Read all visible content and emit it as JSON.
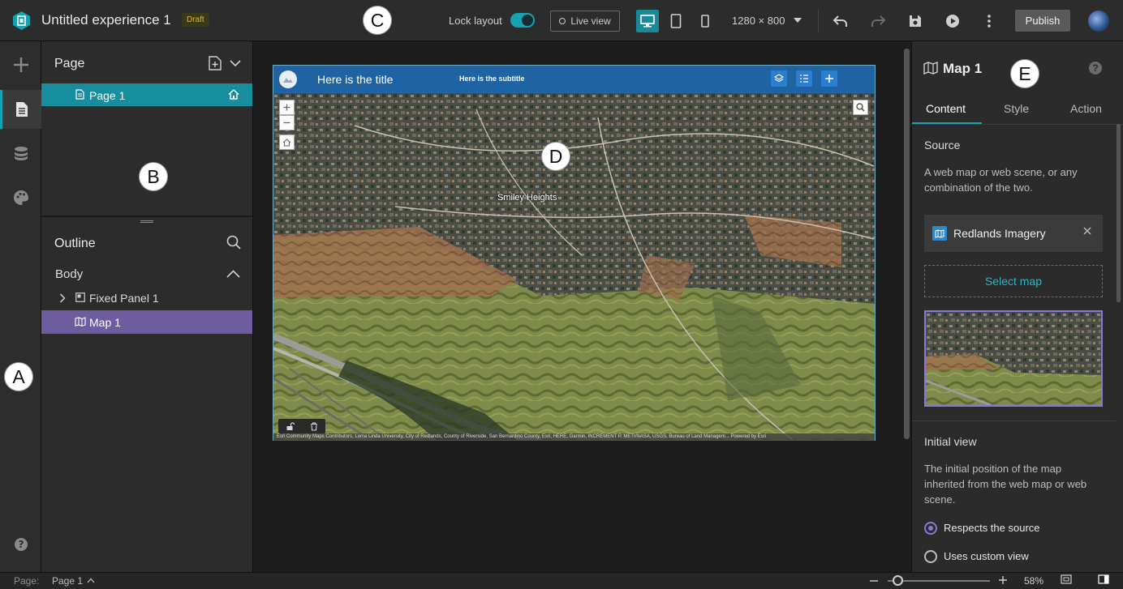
{
  "app": {
    "title": "Untitled experience 1",
    "status_badge": "Draft"
  },
  "toolbar": {
    "lock_layout_label": "Lock layout",
    "lock_layout_on": true,
    "live_view_label": "Live view",
    "resolution": "1280 × 800",
    "publish_label": "Publish"
  },
  "callouts": {
    "a": "A",
    "b": "B",
    "c": "C",
    "d": "D",
    "e": "E"
  },
  "page_panel": {
    "title": "Page",
    "pages": [
      {
        "label": "Page 1",
        "is_home": true
      }
    ]
  },
  "outline": {
    "title": "Outline",
    "body_label": "Body",
    "items": [
      {
        "label": "Fixed Panel 1",
        "selected": false
      },
      {
        "label": "Map 1",
        "selected": true
      }
    ]
  },
  "canvas": {
    "header_title": "Here is the title",
    "header_subtitle": "Here is the subtitle",
    "map_place_label": "Smiley Heights",
    "attribution": "Esri Community Maps Contributors, Loma Linda University, City of Redlands, County of Riverside, San Bernardino County, Esri, HERE, Garmin, INCREMENT P, METI/NASA, USGS, Bureau of Land Managem... Powered by Esri"
  },
  "settings_panel": {
    "widget_title": "Map 1",
    "tabs": [
      "Content",
      "Style",
      "Action"
    ],
    "active_tab": "Content",
    "source_heading": "Source",
    "source_desc": "A web map or web scene, or any combination of the two.",
    "source_name": "Redlands Imagery",
    "select_map_label": "Select map",
    "initial_view_heading": "Initial view",
    "initial_view_desc": "The initial position of the map inherited from the web map or web scene.",
    "options": [
      {
        "label": "Respects the source",
        "selected": true
      },
      {
        "label": "Uses custom view",
        "selected": false
      }
    ]
  },
  "statusbar": {
    "page_label": "Page:",
    "page_name": "Page 1",
    "zoom": "58%"
  },
  "colors": {
    "accent": "#15a3b2",
    "selection": "#6d5c9e",
    "header_blue": "#1f63a2",
    "link": "#29b6c9"
  }
}
